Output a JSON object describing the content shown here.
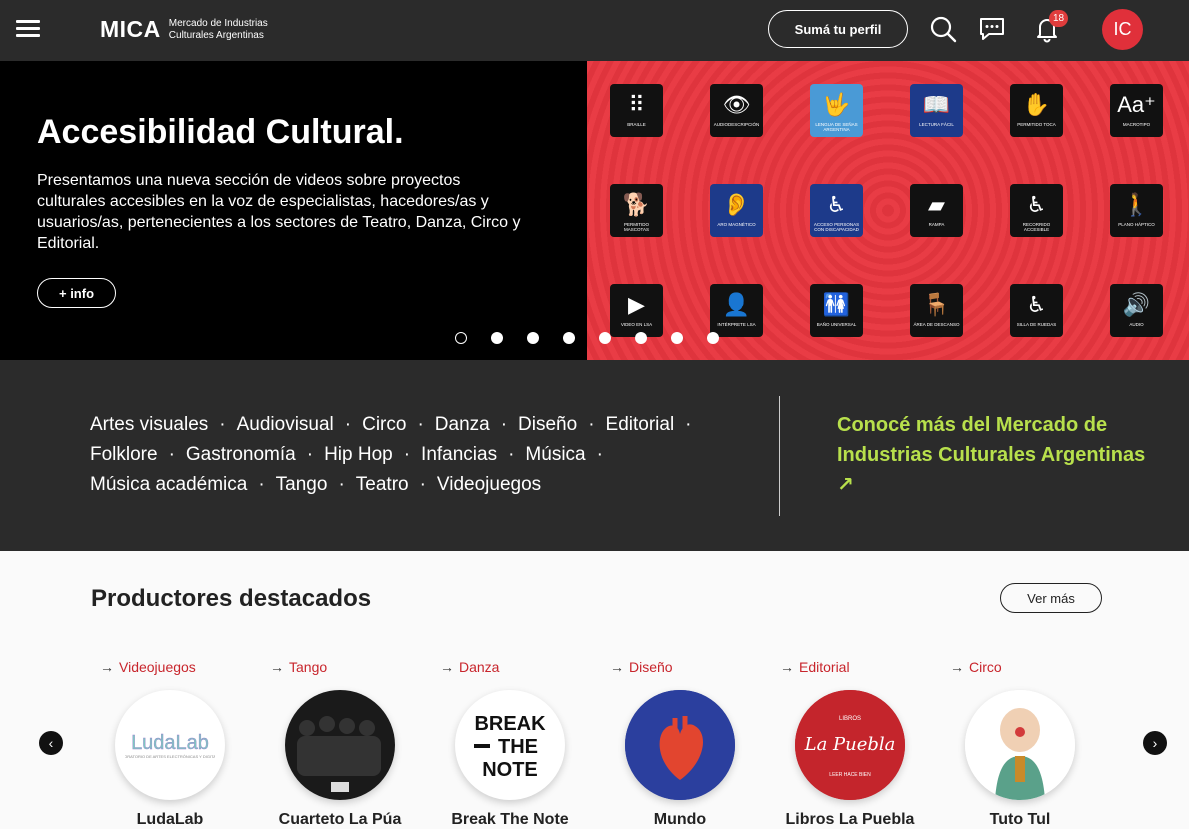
{
  "header": {
    "logo_mark": "MICA",
    "logo_line1": "Mercado de Industrias",
    "logo_line2": "Culturales Argentinas",
    "cta_label": "Sumá tu perfil",
    "notification_count": "18",
    "avatar_initials": "IC",
    "icons": [
      "menu-icon",
      "search-icon",
      "chat-icon",
      "bell-icon"
    ]
  },
  "hero": {
    "title": "Accesibilidad Cultural.",
    "description": "Presentamos una nueva sección de videos sobre proyectos culturales accesibles en la voz de especialistas, hacedores/as y usuarios/as, pertenecientes a los sectores de Teatro, Danza, Circo y Editorial.",
    "button_label": "+ info",
    "accessibility_tiles": [
      {
        "glyph": "⠿",
        "caption": "Braille",
        "style": "dark"
      },
      {
        "glyph": "👁",
        "caption": "Audiodescripción",
        "style": "dark"
      },
      {
        "glyph": "🤟",
        "caption": "Lengua de señas argentina",
        "style": "lblue"
      },
      {
        "glyph": "📖",
        "caption": "Lectura fácil",
        "style": "blue"
      },
      {
        "glyph": "✋",
        "caption": "Permitido toca",
        "style": "dark"
      },
      {
        "glyph": "Aa⁺",
        "caption": "Macrotipo",
        "style": "dark"
      },
      {
        "glyph": "🐕",
        "caption": "Permitido mascotas",
        "style": "dark"
      },
      {
        "glyph": "👂",
        "caption": "Aro magnético",
        "style": "blue"
      },
      {
        "glyph": "♿",
        "caption": "Acceso personas con discapacidad",
        "style": "blue"
      },
      {
        "glyph": "▰",
        "caption": "Rampa",
        "style": "dark"
      },
      {
        "glyph": "♿",
        "caption": "Recorrido accesible",
        "style": "dark"
      },
      {
        "glyph": "🚶",
        "caption": "Plano háptico",
        "style": "dark"
      },
      {
        "glyph": "▶",
        "caption": "Video en LSA",
        "style": "dark"
      },
      {
        "glyph": "👤",
        "caption": "Intérprete LSA",
        "style": "dark"
      },
      {
        "glyph": "🚻",
        "caption": "Baño universal",
        "style": "dark"
      },
      {
        "glyph": "🪑",
        "caption": "Área de descanso",
        "style": "dark"
      },
      {
        "glyph": "♿",
        "caption": "Silla de ruedas",
        "style": "dark"
      },
      {
        "glyph": "🔊",
        "caption": "Audio",
        "style": "dark"
      }
    ],
    "slides_count": 8,
    "active_slide_index": 0
  },
  "categories": {
    "items": [
      "Artes visuales",
      "Audiovisual",
      "Circo",
      "Danza",
      "Diseño",
      "Editorial",
      "Folklore",
      "Gastronomía",
      "Hip Hop",
      "Infancias",
      "Música",
      "Música académica",
      "Tango",
      "Teatro",
      "Videojuegos"
    ],
    "separator": "·",
    "promo_text": "Conocé más del Mercado de Industrias Culturales Argentinas ↗",
    "promo_color": "#b8e04c"
  },
  "producers": {
    "title": "Productores destacados",
    "more_label": "Ver más",
    "prev_label": "‹",
    "next_label": "›",
    "items": [
      {
        "category": "Videojuegos",
        "name": "LudaLab",
        "logo_text": "LudaLab",
        "bg": "#ffffff"
      },
      {
        "category": "Tango",
        "name": "Cuarteto La Púa",
        "logo_text": "",
        "bg": "#ffffff"
      },
      {
        "category": "Danza",
        "name": "Break The Note",
        "logo_text": "BREAK THE NOTE",
        "bg": "#ffffff"
      },
      {
        "category": "Diseño",
        "name": "Mundo",
        "logo_text": "",
        "bg": "#2b3f9e"
      },
      {
        "category": "Editorial",
        "name": "Libros La Puebla",
        "logo_text": "La Puebla",
        "bg": "#c4252c"
      },
      {
        "category": "Circo",
        "name": "Tuto Tul",
        "logo_text": "",
        "bg": "#ffffff"
      }
    ]
  }
}
